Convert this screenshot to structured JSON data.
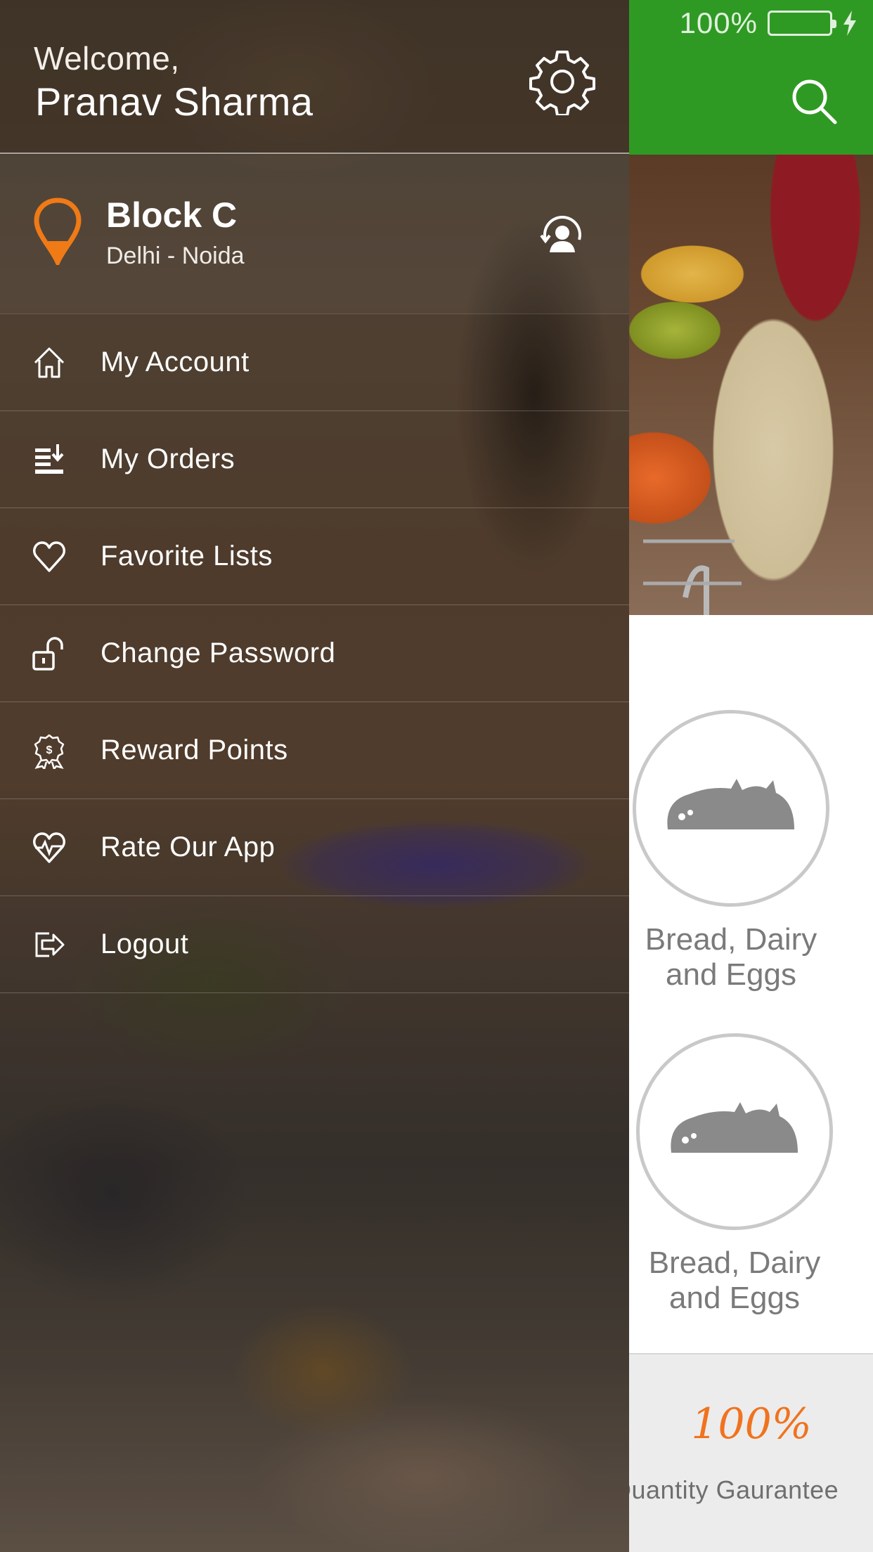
{
  "status_bar": {
    "battery_percent": "100%"
  },
  "header": {
    "search_icon": "search-icon",
    "accent_color": "#2f9a23"
  },
  "categories": [
    {
      "label_line1": "Bread, Dairy",
      "label_line2": "and Eggs",
      "icon": "bread-icon"
    },
    {
      "label_line1": "Bread, Dairy",
      "label_line2": "and Eggs",
      "icon": "bread-icon"
    }
  ],
  "guarantee": {
    "value": "100%",
    "text": "Quantity Gaurantee"
  },
  "drawer": {
    "welcome": "Welcome,",
    "username": "Pranav Sharma",
    "settings_icon": "gear-icon",
    "location": {
      "name": "Block C",
      "area": "Delhi - Noida",
      "pin_color": "#f07a16"
    },
    "menu": [
      {
        "label": "My Account",
        "icon": "home-icon"
      },
      {
        "label": "My Orders",
        "icon": "orders-icon"
      },
      {
        "label": "Favorite Lists",
        "icon": "heart-icon"
      },
      {
        "label": "Change Password",
        "icon": "unlock-icon"
      },
      {
        "label": "Reward Points",
        "icon": "reward-icon"
      },
      {
        "label": "Rate Our App",
        "icon": "rate-heart-icon"
      },
      {
        "label": "Logout",
        "icon": "logout-icon"
      }
    ]
  }
}
